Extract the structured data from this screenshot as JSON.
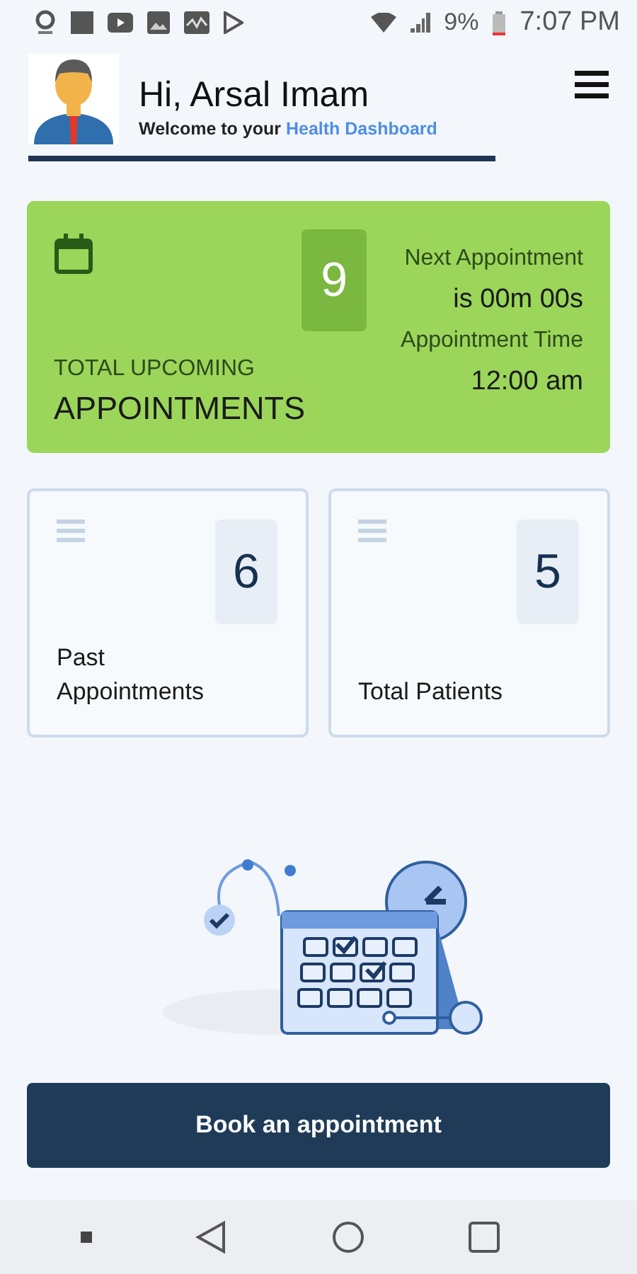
{
  "status_bar": {
    "battery": "9%",
    "time": "7:07 PM"
  },
  "header": {
    "greeting": "Hi, Arsal Imam",
    "subtitle": "Welcome to your",
    "subtitle_link": "Health Dashboard"
  },
  "summary": {
    "count": "9",
    "label_top": "TOTAL UPCOMING",
    "label_main": "APPOINTMENTS",
    "next_label": "Next Appointment",
    "next_value": "is 00m 00s",
    "time_label": "Appointment Time",
    "time_value": "12:00 am"
  },
  "stats": [
    {
      "value": "6",
      "label": "Past Appointments"
    },
    {
      "value": "5",
      "label": "Total Patients"
    }
  ],
  "book_button": "Book an appointment"
}
